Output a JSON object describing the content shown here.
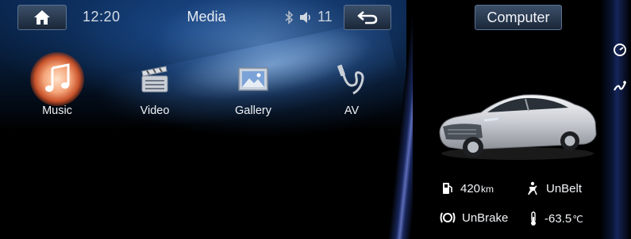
{
  "media": {
    "time": "12:20",
    "title": "Media",
    "volume": "11",
    "apps": [
      {
        "label": "Music",
        "icon": "music-note-icon"
      },
      {
        "label": "Video",
        "icon": "film-clapper-icon"
      },
      {
        "label": "Gallery",
        "icon": "picture-icon"
      },
      {
        "label": "AV",
        "icon": "av-cable-icon"
      }
    ]
  },
  "computer": {
    "title": "Computer",
    "range_value": "420",
    "range_unit": "km",
    "belt_status": "UnBelt",
    "brake_status": "UnBrake",
    "temp_value": "-63.5",
    "temp_unit": "℃"
  },
  "colors": {
    "accent_blue": "#2a5fa8",
    "music_glow": "#e8723f",
    "button_bg": "#2a3a52",
    "divider": "#6d7fd8"
  }
}
